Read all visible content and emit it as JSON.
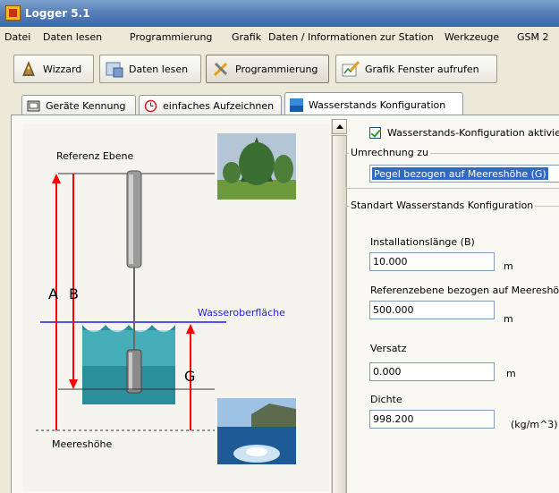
{
  "window": {
    "title": "Logger 5.1"
  },
  "menu": [
    "Datei",
    "Daten lesen",
    "Programmierung",
    "Grafik",
    "Daten / Informationen zur Station",
    "Werkzeuge",
    "GSM 2"
  ],
  "toolbar": {
    "wizzard": "Wizzard",
    "daten_lesen": "Daten lesen",
    "programmierung": "Programmierung",
    "grafik": "Grafik Fenster aufrufen"
  },
  "tabs": [
    "Geräte Kennung",
    "einfaches Aufzeichnen",
    "Wasserstands Konfiguration"
  ],
  "diagram": {
    "referenz": "Referenz Ebene",
    "a": "A",
    "b": "B",
    "g": "G",
    "wasser": "Wasseroberfläche",
    "meer": "Meereshöhe",
    "colors": {
      "red": "#ff0000",
      "blue": "#1a1aff",
      "water": "#2a8f9a"
    }
  },
  "config": {
    "checkbox_label": "Wasserstands-Konfiguration aktivier",
    "umrechnung_legend": "Umrechnung zu",
    "umrechnung_value": "Pegel bezogen auf Meereshöhe (G)",
    "standart_legend": "Standart Wasserstands Konfiguration",
    "install_label": "Installationslänge (B)",
    "install_value": "10.000",
    "install_unit": "m",
    "ref_label": "Referenzebene bezogen auf Meereshö",
    "ref_value": "500.000",
    "ref_unit": "m",
    "versatz_label": "Versatz",
    "versatz_value": "0.000",
    "versatz_unit": "m",
    "dichte_label": "Dichte",
    "dichte_value": "998.200",
    "dichte_unit": "(kg/m^3)"
  }
}
